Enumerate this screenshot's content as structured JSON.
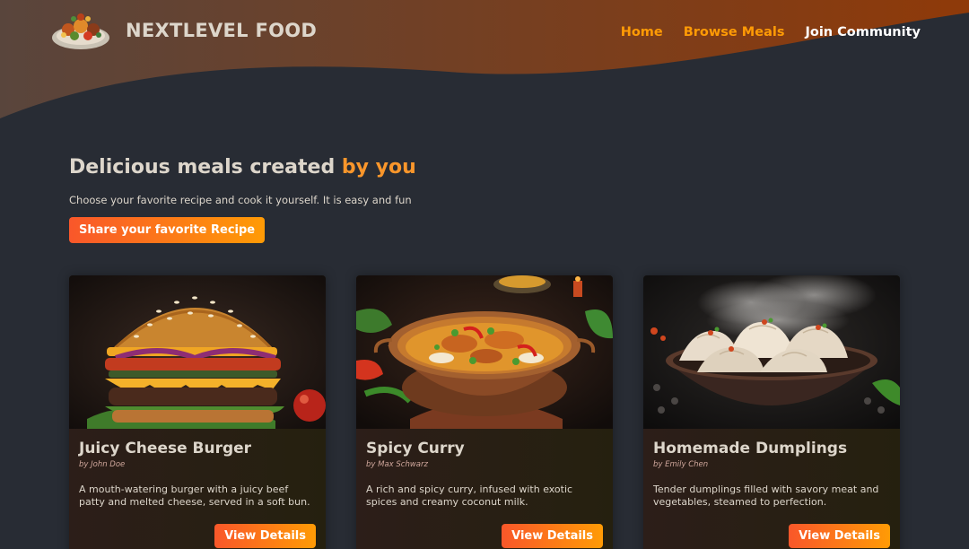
{
  "header": {
    "logo_text": "NextLevel Food",
    "logo_icon": "meal-plate-icon",
    "nav": [
      {
        "label": "Home",
        "active": false
      },
      {
        "label": "Browse Meals",
        "active": false
      },
      {
        "label": "Join Community",
        "active": true
      }
    ]
  },
  "hero": {
    "title_main": "Delicious meals created",
    "title_highlight": "by you",
    "subtitle": "Choose your favorite recipe and cook it yourself. It is easy and fun",
    "cta_label": "Share your favorite Recipe"
  },
  "meals": [
    {
      "title": "Juicy Cheese Burger",
      "author": "by John Doe",
      "summary": "A mouth-watering burger with a juicy beef patty and melted cheese, served in a soft bun.",
      "button_label": "View Details",
      "image_icon": "burger-icon"
    },
    {
      "title": "Spicy Curry",
      "author": "by Max Schwarz",
      "summary": "A rich and spicy curry, infused with exotic spices and creamy coconut milk.",
      "button_label": "View Details",
      "image_icon": "curry-icon"
    },
    {
      "title": "Homemade Dumplings",
      "author": "by Emily Chen",
      "summary": "Tender dumplings filled with savory meat and vegetables, steamed to perfection.",
      "button_label": "View Details",
      "image_icon": "dumplings-icon"
    }
  ],
  "colors": {
    "background": "#282c34",
    "accent_orange": "#ff9b05",
    "accent_red": "#f9572a",
    "text": "#ddd6cb",
    "header_gradient_start": "#59453c",
    "header_gradient_end": "#8f3a09"
  }
}
